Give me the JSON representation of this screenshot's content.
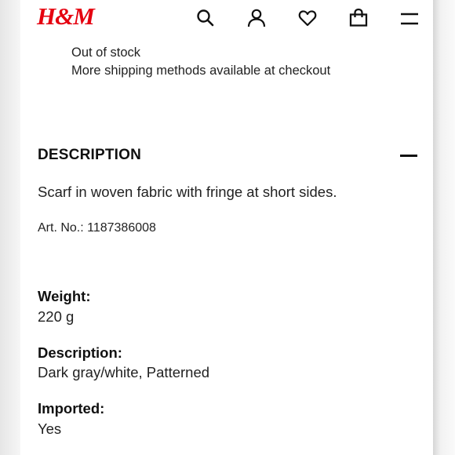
{
  "header": {
    "logo_text": "H&M",
    "brand_color": "#e50010",
    "icons": [
      "search-icon",
      "account-icon",
      "favorites-heart-icon",
      "shopping-bag-icon",
      "menu-hamburger-icon"
    ]
  },
  "shipping": {
    "stock_status": "Out of stock",
    "more_methods": "More shipping methods available at checkout"
  },
  "description_section": {
    "title": "DESCRIPTION",
    "expanded": true,
    "text": "Scarf in woven fabric with fringe at short sides.",
    "article_number": "Art. No.: 1187386008"
  },
  "attributes": [
    {
      "label": "Weight:",
      "value": "220 g"
    },
    {
      "label": "Description:",
      "value": "Dark gray/white, Patterned"
    },
    {
      "label": "Imported:",
      "value": "Yes"
    }
  ]
}
